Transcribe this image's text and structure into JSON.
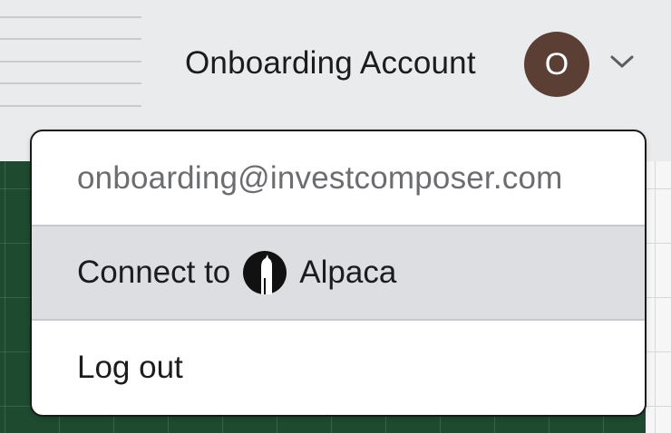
{
  "header": {
    "account_name": "Onboarding Account",
    "avatar_initial": "O",
    "avatar_color": "#5b3f35",
    "chevron_icon": "chevron-down-icon"
  },
  "dropdown": {
    "email": "onboarding@investcomposer.com",
    "connect_prefix": "Connect to",
    "connect_brand": "Alpaca",
    "connect_icon": "alpaca-logo-icon",
    "logout_label": "Log out"
  },
  "colors": {
    "panel_green": "#1e4a30",
    "highlight_row": "#dcdee1"
  }
}
